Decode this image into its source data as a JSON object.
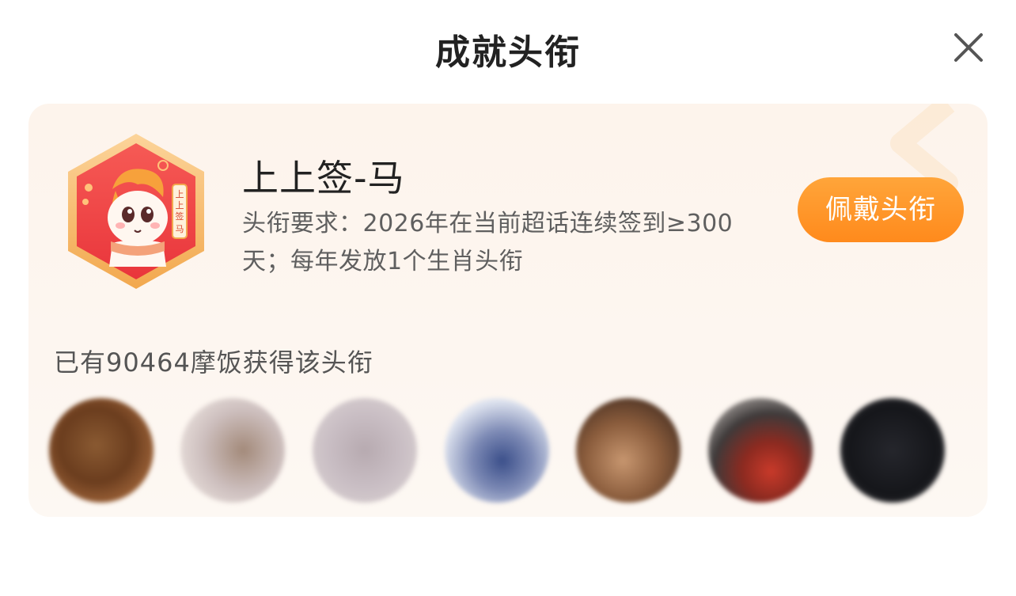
{
  "header": {
    "title": "成就头衔",
    "close_icon": "close-icon"
  },
  "title_card": {
    "badge": {
      "icon": "zodiac-horse-badge-icon",
      "badge_text": "上上签-马",
      "colors": {
        "frame": "#f6b35a",
        "fill": "#f2494a"
      }
    },
    "name": "上上签-马",
    "requirement": "头衔要求：2026年在当前超话连续签到≥300天；每年发放1个生肖头衔",
    "wear_button_label": "佩戴头衔",
    "owner_count_text": "已有90464摩饭获得该头衔",
    "owner_avatars": [
      {
        "name": "avatar-1"
      },
      {
        "name": "avatar-2"
      },
      {
        "name": "avatar-3"
      },
      {
        "name": "avatar-4"
      },
      {
        "name": "avatar-5"
      },
      {
        "name": "avatar-6"
      },
      {
        "name": "avatar-7"
      }
    ]
  },
  "colors": {
    "accent": "#ff8a1c",
    "card_background": "#fdf4ec",
    "title_text": "#222222",
    "secondary_text": "#5f5f5f"
  }
}
